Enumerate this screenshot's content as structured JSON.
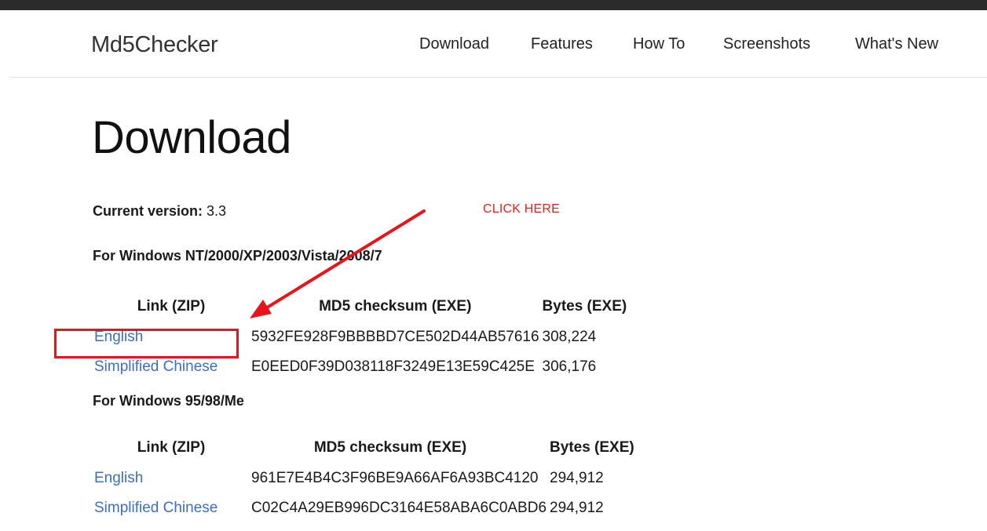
{
  "navbar": {
    "brand": "Md5Checker",
    "links": [
      "Download",
      "Features",
      "How To",
      "Screenshots",
      "What's New"
    ]
  },
  "page": {
    "title": "Download",
    "version_label": "Current version:",
    "version_value": "3.3"
  },
  "sections": [
    {
      "heading": "For Windows NT/2000/XP/2003/Vista/2008/7",
      "columns": [
        "Link (ZIP)",
        "MD5 checksum (EXE)",
        "Bytes (EXE)"
      ],
      "rows": [
        {
          "link": "English",
          "md5": "5932FE928F9BBBBD7CE502D44AB57616",
          "bytes": "308,224"
        },
        {
          "link": "Simplified Chinese",
          "md5": "E0EED0F39D038118F3249E13E59C425E",
          "bytes": "306,176"
        }
      ]
    },
    {
      "heading": "For Windows 95/98/Me",
      "columns": [
        "Link (ZIP)",
        "MD5 checksum (EXE)",
        "Bytes (EXE)"
      ],
      "rows": [
        {
          "link": "English",
          "md5": "961E7E4B4C3F96BE9A66AF6A93BC4120",
          "bytes": "294,912"
        },
        {
          "link": "Simplified Chinese",
          "md5": "C02C4A29EB996DC3164E58ABA6C0ABD6",
          "bytes": "294,912"
        }
      ]
    }
  ],
  "annotation": {
    "text": "CLICK HERE",
    "color": "#e0241b"
  },
  "colors": {
    "link": "#3a6fc4",
    "top_bar": "#2b2b2b"
  }
}
